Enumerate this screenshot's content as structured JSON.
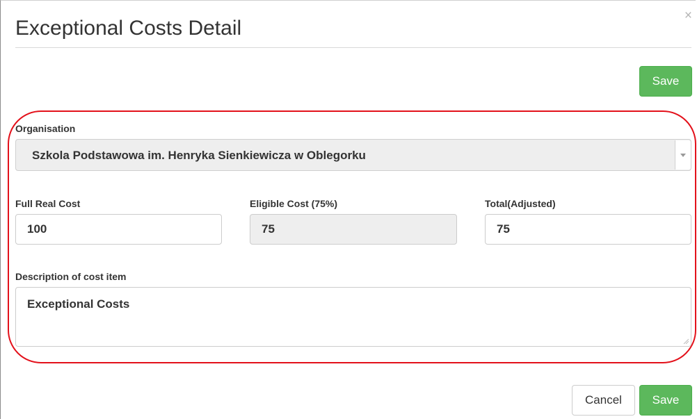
{
  "dialog": {
    "title": "Exceptional Costs Detail",
    "close_glyph": "×"
  },
  "toolbar": {
    "save_label": "Save"
  },
  "form": {
    "organisation": {
      "label": "Organisation",
      "selected_value": "Szkola Podstawowa im. Henryka Sienkiewicza w Oblegorku"
    },
    "full_real_cost": {
      "label": "Full Real Cost",
      "value": "100"
    },
    "eligible_cost": {
      "label": "Eligible Cost (75%)",
      "value": "75"
    },
    "total_adjusted": {
      "label": "Total(Adjusted)",
      "value": "75"
    },
    "description": {
      "label": "Description of cost item",
      "value": "Exceptional Costs"
    }
  },
  "footer": {
    "cancel_label": "Cancel",
    "save_label": "Save"
  },
  "colors": {
    "save_button": "#5cb85c",
    "highlight_ring": "#e3101a",
    "readonly_field": "#eeeeee"
  },
  "icons": {
    "close": "close-icon",
    "dropdown": "chevron-down-icon",
    "resize": "resize-grip-icon"
  }
}
